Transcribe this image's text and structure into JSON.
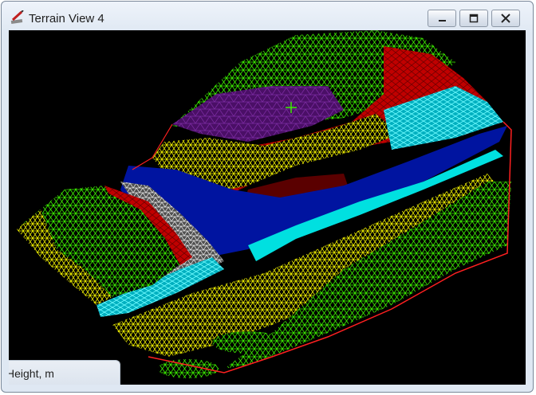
{
  "window": {
    "title": "Terrain View 4",
    "icon": "pencil-ruler-icon"
  },
  "caption_buttons": [
    "minimize-icon",
    "maximize-icon",
    "close-icon"
  ],
  "legend": {
    "label": "Height, m"
  },
  "palette": {
    "background": "#000000",
    "green": "#3cf000",
    "yellow": "#f0f000",
    "red": "#d20000",
    "dark_red": "#6e0000",
    "purple": "#6e1890",
    "cyan": "#00e6e6",
    "blue": "#0014a0",
    "white": "#d8d8d8",
    "boundary": "#ff2020"
  }
}
